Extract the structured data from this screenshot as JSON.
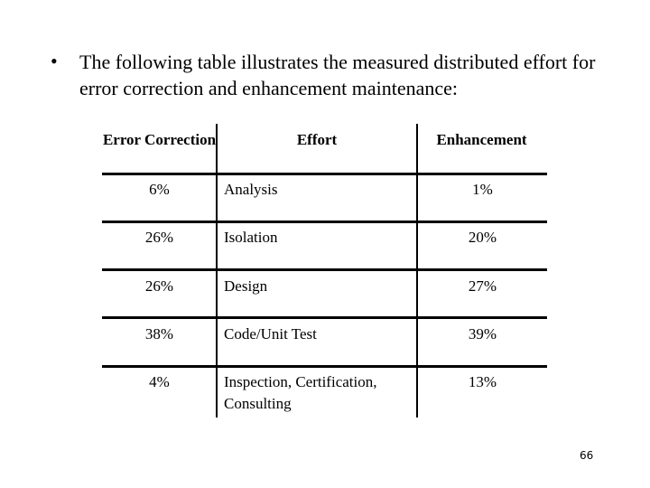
{
  "slide": {
    "bullet_glyph": "•",
    "bullet_text": "The following table illustrates the measured distributed effort for error correction and enhancement maintenance:",
    "page_number": "66"
  },
  "table": {
    "headers": {
      "error_correction": "Error Correction",
      "effort": "Effort",
      "enhancement": "Enhancement"
    },
    "rows": [
      {
        "error_correction": "6%",
        "effort": "Analysis",
        "enhancement": "1%"
      },
      {
        "error_correction": "26%",
        "effort": "Isolation",
        "enhancement": "20%"
      },
      {
        "error_correction": "26%",
        "effort": "Design",
        "enhancement": "27%"
      },
      {
        "error_correction": "38%",
        "effort": "Code/Unit Test",
        "enhancement": "39%"
      },
      {
        "error_correction": "4%",
        "effort": "Inspection, Certification, Consulting",
        "enhancement": "13%"
      }
    ]
  }
}
